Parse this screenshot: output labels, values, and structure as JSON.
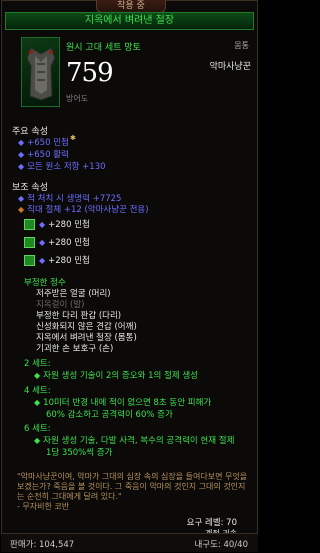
{
  "header": {
    "equipped": "착용 중",
    "title": "지옥에서 벼려낸 철장"
  },
  "item": {
    "type": "원시 고대 세트 망토",
    "slot": "몸통",
    "armor": "759",
    "armor_label": "방어도",
    "class_label": "악마사냥꾼"
  },
  "primary": {
    "heading": "주요 속성",
    "stats": [
      "+650 민첩",
      "+650 활력",
      "모든 원소 저항 +130"
    ]
  },
  "secondary": {
    "heading": "보조 속성",
    "stats": [
      "적 처치 시 생명력 +7725",
      "직대 절체 +12 (악마사냥꾼 전용)"
    ]
  },
  "sockets": [
    "+280 민첩",
    "+280 민첩",
    "+280 민첩"
  ],
  "set": {
    "name": "부정한 정수",
    "pieces_owned": [
      "저주받은 얼굴 (머리)",
      "부정한 다리 판갑 (다리)",
      "신성화되지 않은 견갑 (어깨)",
      "지옥에서 벼려낸 철장 (몸통)",
      "기괴한 손 보호구 (손)"
    ],
    "pieces_missing": [
      "지옥걸이 (발)"
    ],
    "bonus2_label": "2 세트:",
    "bonus2_text": "자원 생성 기술이 2의 증오와 1의 절제 생성",
    "bonus4_label": "4 세트:",
    "bonus4_text1": "10미터 반경 내에 적이 없으면 8초 동안 피해가",
    "bonus4_text2": "60% 감소하고 공격력이 60% 증가",
    "bonus6_label": "6 세트:",
    "bonus6_text1": "자원 생성 기술, 다발 사격, 복수의 공격력이 현재 절제",
    "bonus6_text2": "1당 350%씩 증가"
  },
  "flavor": {
    "text": "\"악마사냥꾼이여, 악마가 그대의 심장 속의 심장을 들여다보면 무엇을 보겠는가? 죽음을 볼 것이다. 그 죽음이 악마의 것인지 그대의 것인지는 순전히 그대에게 달려 있다.\"",
    "author": "- 무자비한 코반"
  },
  "requirements": {
    "level": "요구 레벨: 70",
    "bound": "계정 귀속"
  },
  "footer": {
    "sell": "판매가: 104,547",
    "durability": "내구도: 40/40"
  },
  "colors": {
    "set_green": "#3ee24f",
    "magic_blue": "#6d6dff",
    "legendary_orange": "#c9782b"
  }
}
